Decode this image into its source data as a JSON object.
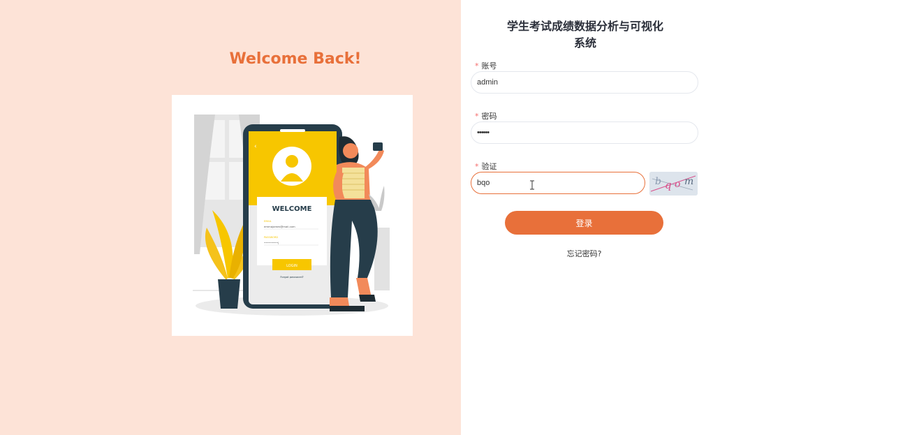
{
  "left": {
    "welcome_title": "Welcome Back!",
    "illustration": {
      "phone_heading": "WELCOME",
      "email_label": "EMAIL",
      "email_value": "emmajames@mail.com",
      "password_label": "PASSWORD",
      "password_value": "•••••••••|",
      "login_label": "LOGIN",
      "forgot_label": "Forgot password?"
    }
  },
  "form": {
    "title": "学生考试成绩数据分析与可视化系统",
    "required_mark": "*",
    "account_label": "账号",
    "account_value": "admin",
    "password_label": "密码",
    "password_value": "••••••",
    "captcha_label": "验证",
    "captcha_value": "bqo",
    "captcha_image_text": "bqom",
    "login_button": "登录",
    "forgot_password": "忘记密码?"
  },
  "colors": {
    "accent": "#e8703a",
    "left_bg": "#fde3d7",
    "title_dark": "#2b2f3a",
    "required": "#f56c6c"
  }
}
